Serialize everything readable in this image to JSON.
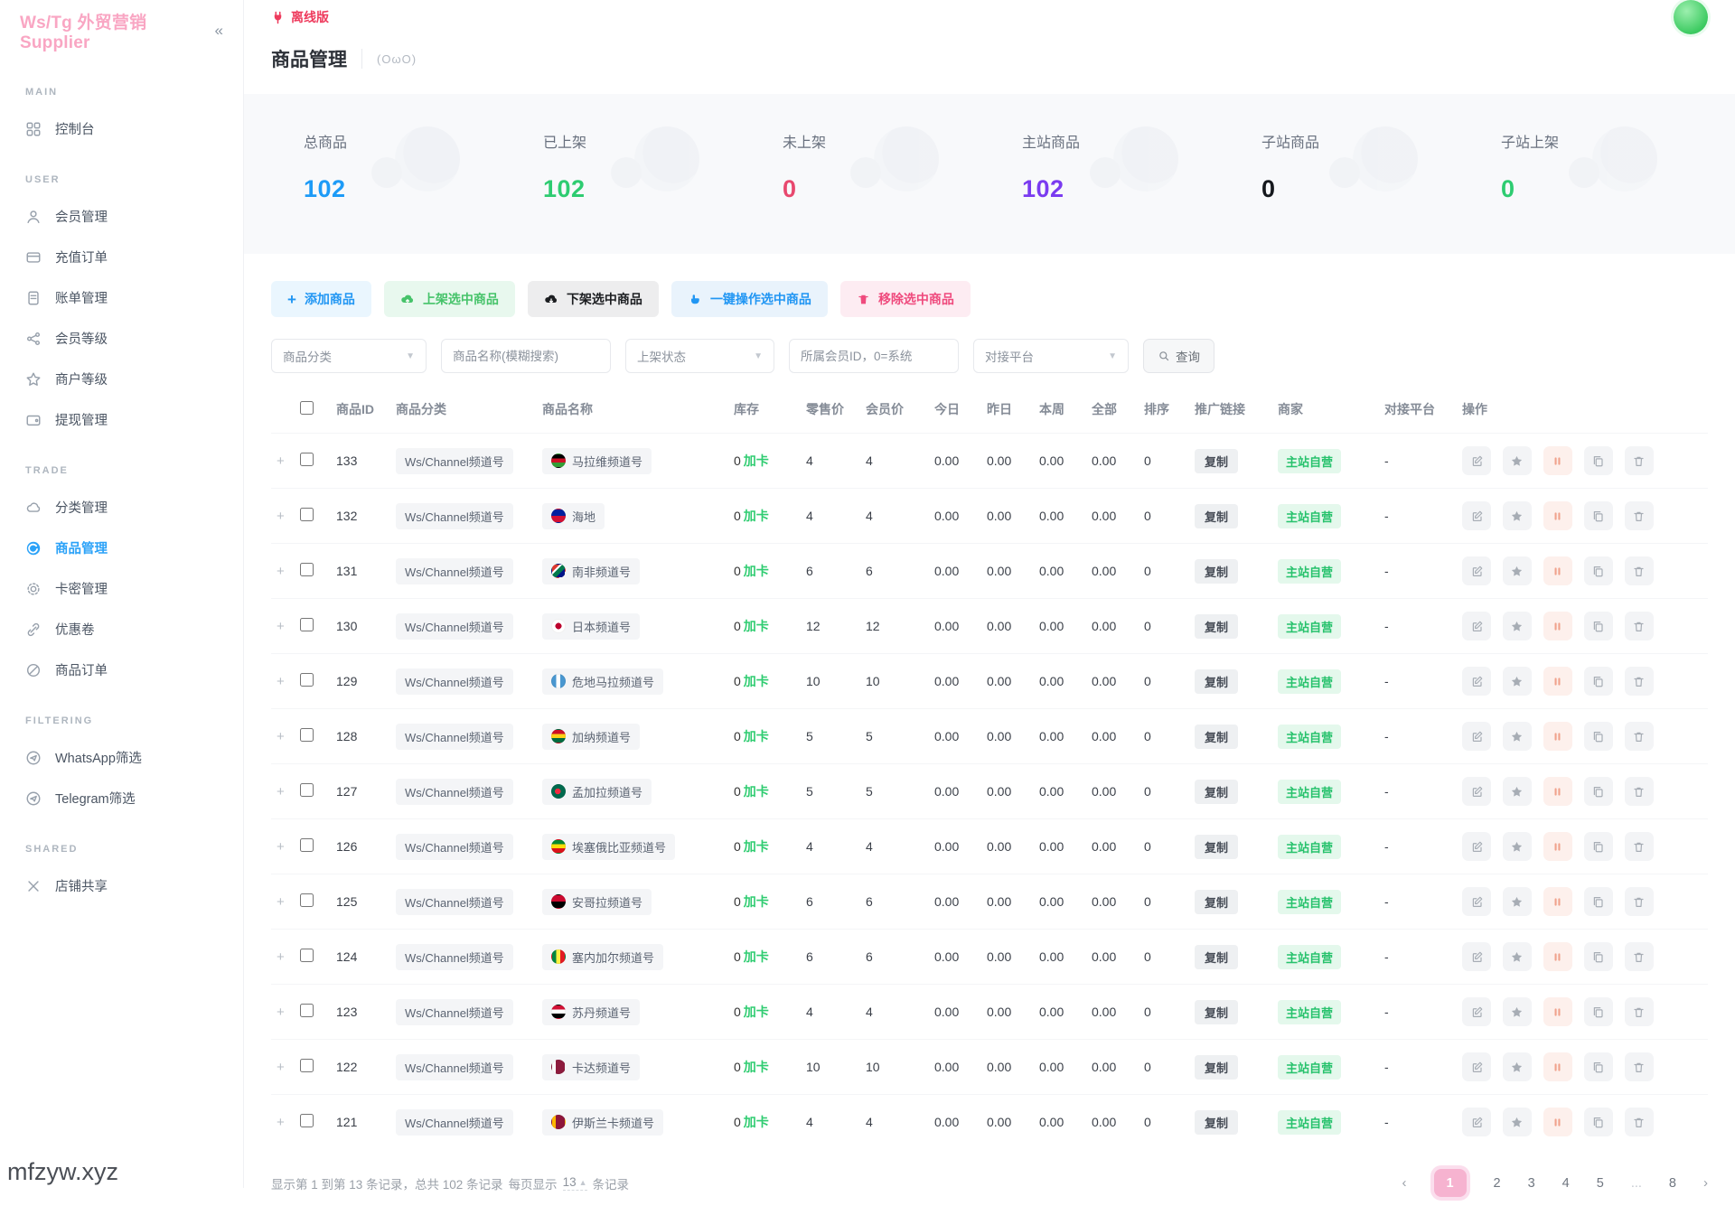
{
  "app": {
    "logo": "Ws/Tg 外贸营销 Supplier",
    "collapse_icon": "«",
    "offline_label": "离线版"
  },
  "sidebar": {
    "sections": [
      {
        "label": "MAIN",
        "items": [
          {
            "label": "控制台"
          }
        ]
      },
      {
        "label": "USER",
        "items": [
          {
            "label": "会员管理"
          },
          {
            "label": "充值订单"
          },
          {
            "label": "账单管理"
          },
          {
            "label": "会员等级"
          },
          {
            "label": "商户等级"
          },
          {
            "label": "提现管理"
          }
        ]
      },
      {
        "label": "TRADE",
        "items": [
          {
            "label": "分类管理"
          },
          {
            "label": "商品管理",
            "active": true
          },
          {
            "label": "卡密管理"
          },
          {
            "label": "优惠卷"
          },
          {
            "label": "商品订单"
          }
        ]
      },
      {
        "label": "FILTERING",
        "items": [
          {
            "label": "WhatsApp筛选"
          },
          {
            "label": "Telegram筛选"
          }
        ]
      },
      {
        "label": "SHARED",
        "items": [
          {
            "label": "店铺共享"
          }
        ]
      }
    ]
  },
  "page": {
    "title": "商品管理",
    "subtitle": "(OωO)"
  },
  "stats": [
    {
      "label": "总商品",
      "value": "102",
      "color": "#1d9bf7"
    },
    {
      "label": "已上架",
      "value": "102",
      "color": "#2ecc71"
    },
    {
      "label": "未上架",
      "value": "0",
      "color": "#e8486e"
    },
    {
      "label": "主站商品",
      "value": "102",
      "color": "#7a3bf0"
    },
    {
      "label": "子站商品",
      "value": "0",
      "color": "#15181d"
    },
    {
      "label": "子站上架",
      "value": "0",
      "color": "#2ecc71"
    }
  ],
  "toolbar": {
    "add": "添加商品",
    "put_on": "上架选中商品",
    "take_off": "下架选中商品",
    "one_key": "一键操作选中商品",
    "remove": "移除选中商品"
  },
  "filters": {
    "category": "商品分类",
    "name_placeholder": "商品名称(模糊搜索)",
    "status": "上架状态",
    "member_placeholder": "所属会员ID，0=系统",
    "platform": "对接平台",
    "search_label": "查询"
  },
  "table": {
    "headers": [
      "商品ID",
      "商品分类",
      "商品名称",
      "库存",
      "零售价",
      "会员价",
      "今日",
      "昨日",
      "本周",
      "全部",
      "排序",
      "推广链接",
      "商家",
      "对接平台",
      "操作"
    ],
    "rows": [
      {
        "id": "133",
        "category": "Ws/Channel频道号",
        "flag_css": "linear-gradient(180deg,#000 0% 33%,#ce1126 33% 66%,#339e35 66% 100%)",
        "name": "马拉维频道号",
        "stock_num": "0",
        "stock_label": "加卡",
        "retail": "4",
        "member": "4",
        "today": "0.00",
        "yesterday": "0.00",
        "week": "0.00",
        "total": "0.00",
        "sort": "0",
        "promo": "复制",
        "merchant": "主站自营",
        "platform": "-"
      },
      {
        "id": "132",
        "category": "Ws/Channel频道号",
        "flag_css": "linear-gradient(180deg,#00209f 0% 50%,#d21034 50% 100%)",
        "name": "海地",
        "stock_num": "0",
        "stock_label": "加卡",
        "retail": "4",
        "member": "4",
        "today": "0.00",
        "yesterday": "0.00",
        "week": "0.00",
        "total": "0.00",
        "sort": "0",
        "promo": "复制",
        "merchant": "主站自营",
        "platform": "-"
      },
      {
        "id": "131",
        "category": "Ws/Channel频道号",
        "flag_css": "linear-gradient(135deg,#de3831 0% 30%,#ffffff 30% 40%,#007a4d 40% 65%,#001489 65% 100%)",
        "name": "南非频道号",
        "stock_num": "0",
        "stock_label": "加卡",
        "retail": "6",
        "member": "6",
        "today": "0.00",
        "yesterday": "0.00",
        "week": "0.00",
        "total": "0.00",
        "sort": "0",
        "promo": "复制",
        "merchant": "主站自营",
        "platform": "-"
      },
      {
        "id": "130",
        "category": "Ws/Channel频道号",
        "flag_css": "radial-gradient(circle at 50% 50%, #bc002d 0 34%, #ffffff 36%)",
        "name": "日本频道号",
        "stock_num": "0",
        "stock_label": "加卡",
        "retail": "12",
        "member": "12",
        "today": "0.00",
        "yesterday": "0.00",
        "week": "0.00",
        "total": "0.00",
        "sort": "0",
        "promo": "复制",
        "merchant": "主站自营",
        "platform": "-"
      },
      {
        "id": "129",
        "category": "Ws/Channel频道号",
        "flag_css": "linear-gradient(90deg,#4997d0 0% 33%,#ffffff 33% 66%,#4997d0 66% 100%)",
        "name": "危地马拉频道号",
        "stock_num": "0",
        "stock_label": "加卡",
        "retail": "10",
        "member": "10",
        "today": "0.00",
        "yesterday": "0.00",
        "week": "0.00",
        "total": "0.00",
        "sort": "0",
        "promo": "复制",
        "merchant": "主站自营",
        "platform": "-"
      },
      {
        "id": "128",
        "category": "Ws/Channel频道号",
        "flag_css": "linear-gradient(180deg,#ce1126 0% 33%,#fcd116 33% 66%,#006b3f 66% 100%)",
        "name": "加纳频道号",
        "stock_num": "0",
        "stock_label": "加卡",
        "retail": "5",
        "member": "5",
        "today": "0.00",
        "yesterday": "0.00",
        "week": "0.00",
        "total": "0.00",
        "sort": "0",
        "promo": "复制",
        "merchant": "主站自营",
        "platform": "-"
      },
      {
        "id": "127",
        "category": "Ws/Channel频道号",
        "flag_css": "radial-gradient(circle at 45% 50%, #f42a41 0 30%, #006a4e 32%)",
        "name": "孟加拉频道号",
        "stock_num": "0",
        "stock_label": "加卡",
        "retail": "5",
        "member": "5",
        "today": "0.00",
        "yesterday": "0.00",
        "week": "0.00",
        "total": "0.00",
        "sort": "0",
        "promo": "复制",
        "merchant": "主站自营",
        "platform": "-"
      },
      {
        "id": "126",
        "category": "Ws/Channel频道号",
        "flag_css": "linear-gradient(180deg,#078930 0% 33%,#fcdd09 33% 66%,#da121a 66% 100%)",
        "name": "埃塞俄比亚频道号",
        "stock_num": "0",
        "stock_label": "加卡",
        "retail": "4",
        "member": "4",
        "today": "0.00",
        "yesterday": "0.00",
        "week": "0.00",
        "total": "0.00",
        "sort": "0",
        "promo": "复制",
        "merchant": "主站自营",
        "platform": "-"
      },
      {
        "id": "125",
        "category": "Ws/Channel频道号",
        "flag_css": "linear-gradient(180deg,#cc092f 0% 50%,#000000 50% 100%)",
        "name": "安哥拉频道号",
        "stock_num": "0",
        "stock_label": "加卡",
        "retail": "6",
        "member": "6",
        "today": "0.00",
        "yesterday": "0.00",
        "week": "0.00",
        "total": "0.00",
        "sort": "0",
        "promo": "复制",
        "merchant": "主站自营",
        "platform": "-"
      },
      {
        "id": "124",
        "category": "Ws/Channel频道号",
        "flag_css": "linear-gradient(90deg,#00853f 0% 33%,#fdef42 33% 66%,#e31b23 66% 100%)",
        "name": "塞内加尔频道号",
        "stock_num": "0",
        "stock_label": "加卡",
        "retail": "6",
        "member": "6",
        "today": "0.00",
        "yesterday": "0.00",
        "week": "0.00",
        "total": "0.00",
        "sort": "0",
        "promo": "复制",
        "merchant": "主站自营",
        "platform": "-"
      },
      {
        "id": "123",
        "category": "Ws/Channel频道号",
        "flag_css": "linear-gradient(180deg,#d21034 0% 33%,#ffffff 33% 66%,#000000 66% 100%)",
        "name": "苏丹频道号",
        "stock_num": "0",
        "stock_label": "加卡",
        "retail": "4",
        "member": "4",
        "today": "0.00",
        "yesterday": "0.00",
        "week": "0.00",
        "total": "0.00",
        "sort": "0",
        "promo": "复制",
        "merchant": "主站自营",
        "platform": "-"
      },
      {
        "id": "122",
        "category": "Ws/Channel频道号",
        "flag_css": "linear-gradient(90deg,#ffffff 0% 30%,#8d1b3d 30% 100%)",
        "name": "卡达频道号",
        "stock_num": "0",
        "stock_label": "加卡",
        "retail": "10",
        "member": "10",
        "today": "0.00",
        "yesterday": "0.00",
        "week": "0.00",
        "total": "0.00",
        "sort": "0",
        "promo": "复制",
        "merchant": "主站自营",
        "platform": "-"
      },
      {
        "id": "121",
        "category": "Ws/Channel频道号",
        "flag_css": "linear-gradient(90deg,#ffb700 0% 30%,#8d153a 30% 100%)",
        "name": "伊斯兰卡频道号",
        "stock_num": "0",
        "stock_label": "加卡",
        "retail": "4",
        "member": "4",
        "today": "0.00",
        "yesterday": "0.00",
        "week": "0.00",
        "total": "0.00",
        "sort": "0",
        "promo": "复制",
        "merchant": "主站自营",
        "platform": "-"
      }
    ]
  },
  "footer": {
    "summary": "显示第 1 到第 13 条记录，总共 102 条记录",
    "page_size_prefix": "每页显示",
    "page_size": "13",
    "page_size_suffix": "条记录",
    "pagination": {
      "prev": "‹",
      "p1": "1",
      "p2": "2",
      "p3": "3",
      "p4": "4",
      "p5": "5",
      "ellipsis": "...",
      "p8": "8",
      "next": "›"
    }
  },
  "watermark": "mfzyw.xyz"
}
